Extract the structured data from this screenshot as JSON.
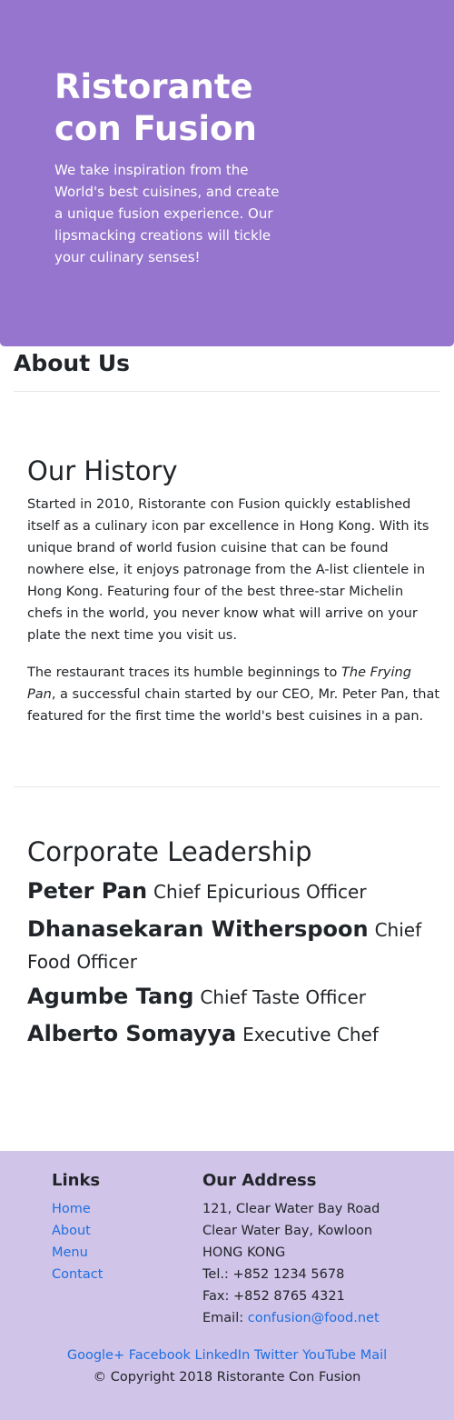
{
  "hero": {
    "title": "Ristorante con Fusion",
    "text": "We take inspiration from the World's best cuisines, and create a unique fusion experience. Our lipsmacking creations will tickle your culinary senses!"
  },
  "about": {
    "heading": "About Us"
  },
  "history": {
    "title": "Our History",
    "para1": "Started in 2010, Ristorante con Fusion quickly established itself as a culinary icon par excellence in Hong Kong. With its unique brand of world fusion cuisine that can be found nowhere else, it enjoys patronage from the A-list clientele in Hong Kong. Featuring four of the best three-star Michelin chefs in the world, you never know what will arrive on your plate the next time you visit us.",
    "para2_before": "The restaurant traces its humble beginnings to ",
    "para2_italic": "The Frying Pan",
    "para2_after": ", a successful chain started by our CEO, Mr. Peter Pan, that featured for the first time the world's best cuisines in a pan."
  },
  "leadership": {
    "title": "Corporate Leadership",
    "leaders": [
      {
        "name": "Peter Pan",
        "role": "Chief Epicurious Officer"
      },
      {
        "name": "Dhanasekaran Witherspoon",
        "role": "Chief Food Officer"
      },
      {
        "name": "Agumbe Tang",
        "role": "Chief Taste Officer"
      },
      {
        "name": "Alberto Somayya",
        "role": "Executive Chef"
      }
    ]
  },
  "footer": {
    "links_heading": "Links",
    "links": [
      "Home",
      "About",
      "Menu",
      "Contact"
    ],
    "address_heading": "Our Address",
    "address_lines": [
      "121, Clear Water Bay Road",
      "Clear Water Bay, Kowloon",
      "HONG KONG",
      "Tel.: +852 1234 5678",
      "Fax: +852 8765 4321"
    ],
    "email_label": "Email: ",
    "email": "confusion@food.net",
    "social": [
      "Google+",
      "Facebook",
      "LinkedIn",
      "Twitter",
      "YouTube",
      "Mail"
    ],
    "copyright": "© Copyright 2018 Ristorante Con Fusion"
  }
}
